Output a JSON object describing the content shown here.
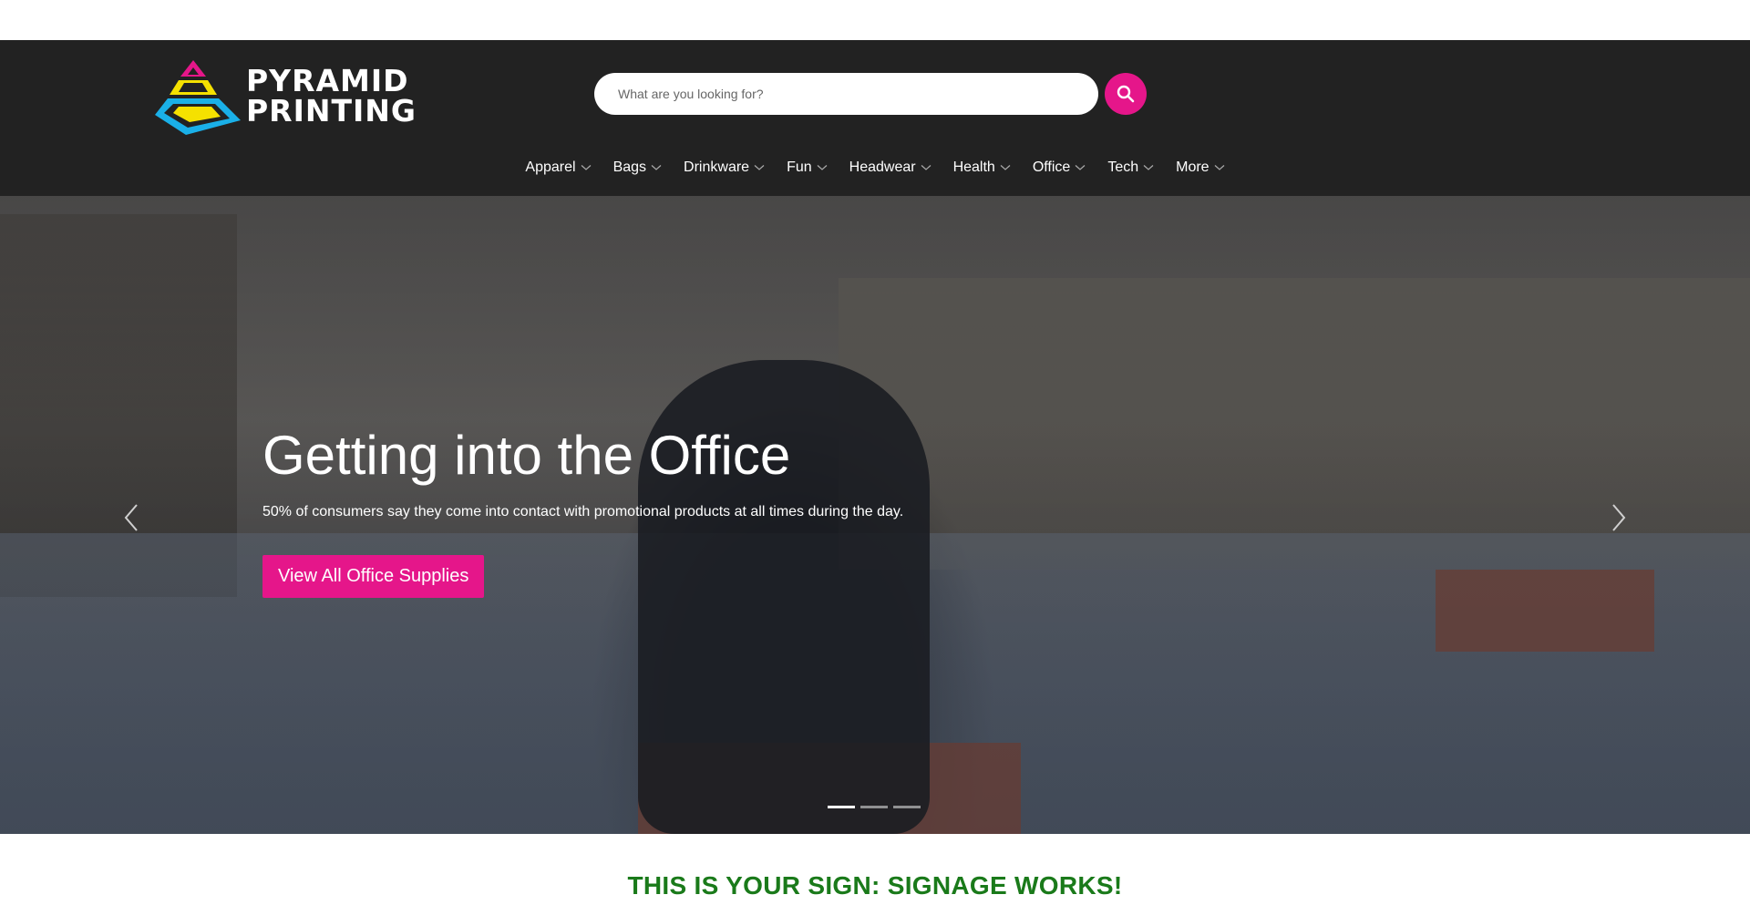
{
  "brand": {
    "line1": "PYRAMID",
    "line2": "PRINTING"
  },
  "search": {
    "placeholder": "What are you looking for?",
    "button_icon": "search-icon"
  },
  "nav": {
    "items": [
      {
        "label": "Apparel"
      },
      {
        "label": "Bags"
      },
      {
        "label": "Drinkware"
      },
      {
        "label": "Fun"
      },
      {
        "label": "Headwear"
      },
      {
        "label": "Health"
      },
      {
        "label": "Office"
      },
      {
        "label": "Tech"
      },
      {
        "label": "More"
      }
    ],
    "caret_icon": "chevron-down-icon"
  },
  "hero": {
    "title": "Getting into the Office",
    "subtitle": "50% of consumers say they come into contact with promotional products at all times during the day.",
    "cta_label": "View All Office Supplies",
    "prev_icon": "chevron-left-icon",
    "next_icon": "chevron-right-icon",
    "slide_count": 3,
    "active_slide": 1
  },
  "promo": {
    "heading": "THIS IS YOUR SIGN: SIGNAGE WORKS!"
  },
  "colors": {
    "accent": "#e5168a",
    "header_bg": "#222222",
    "promo_text": "#1a7a1a",
    "logo_magenta": "#e5168a",
    "logo_yellow": "#f5e100",
    "logo_cyan": "#1ab0e8"
  }
}
